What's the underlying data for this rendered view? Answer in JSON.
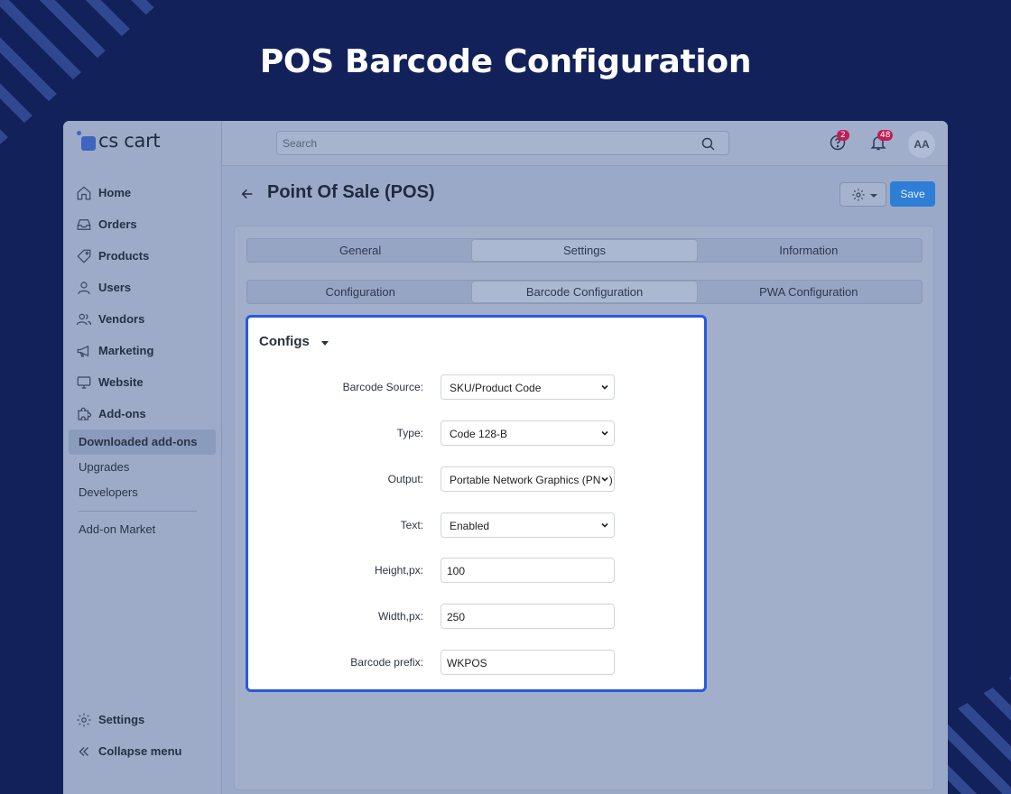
{
  "hero_title": "POS Barcode Configuration",
  "app": {
    "logo": "cs cart",
    "search_placeholder": "Search",
    "help_badge": "2",
    "notifications_badge": "48",
    "avatar_initials": "AA"
  },
  "sidebar": {
    "items": [
      {
        "label": "Home",
        "icon": "home-icon"
      },
      {
        "label": "Orders",
        "icon": "inbox-icon"
      },
      {
        "label": "Products",
        "icon": "tag-icon"
      },
      {
        "label": "Users",
        "icon": "user-icon"
      },
      {
        "label": "Vendors",
        "icon": "users-icon"
      },
      {
        "label": "Marketing",
        "icon": "megaphone-icon"
      },
      {
        "label": "Website",
        "icon": "monitor-icon"
      },
      {
        "label": "Add-ons",
        "icon": "puzzle-icon"
      }
    ],
    "subitems": [
      "Downloaded add-ons",
      "Upgrades",
      "Developers"
    ],
    "market": "Add-on Market",
    "settings": "Settings",
    "collapse": "Collapse menu"
  },
  "page": {
    "title": "Point Of Sale (POS)",
    "save_label": "Save"
  },
  "tabs_main": [
    {
      "label": "General",
      "active": false
    },
    {
      "label": "Settings",
      "active": true
    },
    {
      "label": "Information",
      "active": false
    }
  ],
  "tabs_sub": [
    {
      "label": "Configuration",
      "active": false
    },
    {
      "label": "Barcode Configuration",
      "active": true
    },
    {
      "label": "PWA Configuration",
      "active": false
    }
  ],
  "configs": {
    "title": "Configs",
    "fields": [
      {
        "label": "Barcode Source:",
        "value": "SKU/Product Code",
        "type": "select"
      },
      {
        "label": "Type:",
        "value": "Code 128-B",
        "type": "select"
      },
      {
        "label": "Output:",
        "value": "Portable Network Graphics (PNG)",
        "type": "select"
      },
      {
        "label": "Text:",
        "value": "Enabled",
        "type": "select"
      },
      {
        "label": "Height,px:",
        "value": "100",
        "type": "input"
      },
      {
        "label": "Width,px:",
        "value": "250",
        "type": "input"
      },
      {
        "label": "Barcode prefix:",
        "value": "WKPOS",
        "type": "input"
      }
    ]
  }
}
